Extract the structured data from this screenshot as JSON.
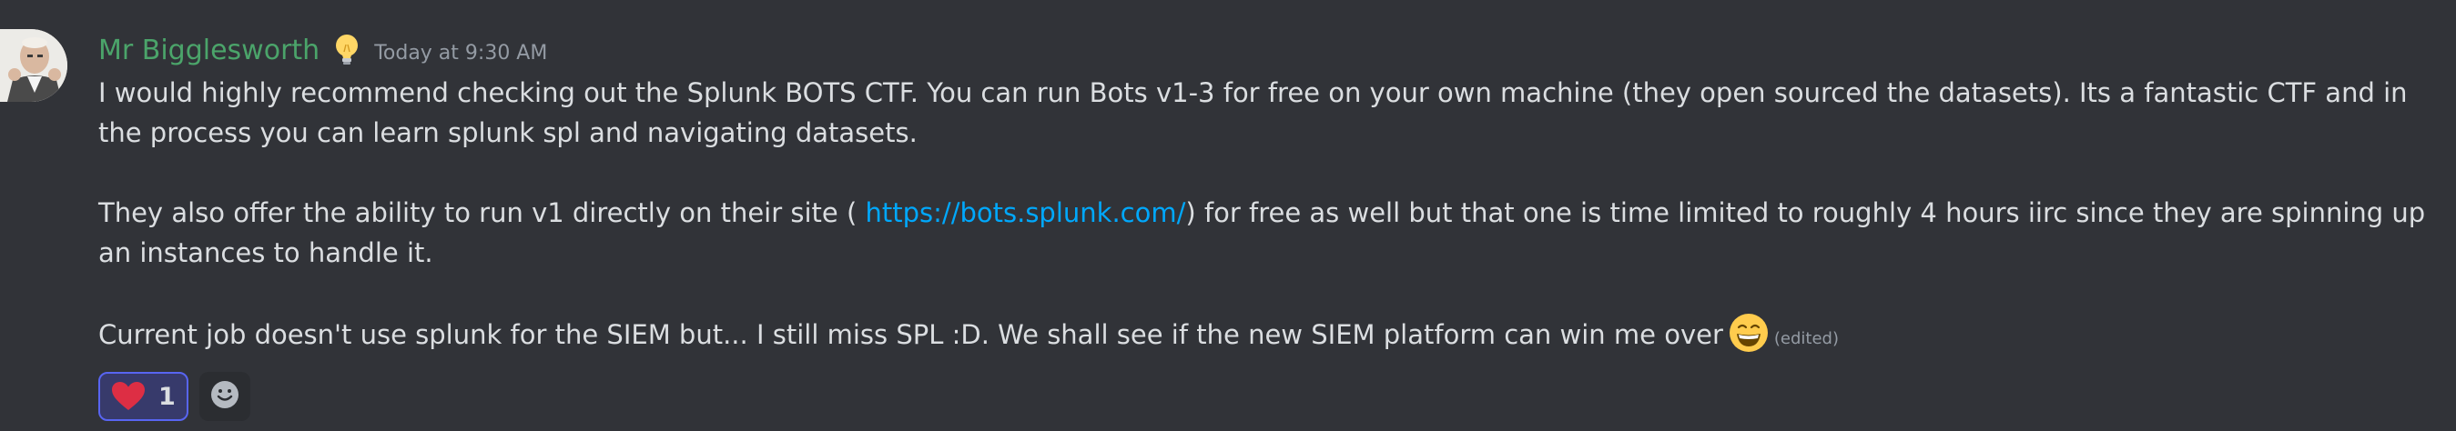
{
  "message": {
    "author": "Mr Bigglesworth",
    "author_badge_icon": "lightbulb-icon",
    "timestamp": "Today at 9:30 AM",
    "paragraph1": "I would highly recommend checking out the Splunk BOTS CTF. You can run Bots v1-3 for free on your own machine (they open sourced the datasets). Its a fantastic CTF and in the process you can learn splunk spl and navigating datasets.",
    "paragraph2_before": "They also offer the ability to run v1 directly on their site  ( ",
    "paragraph2_link": "https://bots.splunk.com/",
    "paragraph2_after": ") for free as well but that one is time limited to roughly 4 hours iirc since they are spinning up an instances to handle it.",
    "paragraph3": "Current job doesn't use splunk for the SIEM but... I still miss SPL :D. We shall see if the new SIEM platform can win me over",
    "paragraph3_emoji": "grinning-face-icon",
    "edited_label": "(edited)"
  },
  "reactions": [
    {
      "emoji": "red-heart-icon",
      "count": "1"
    }
  ],
  "add_reaction_icon": "add-reaction-smiley-icon",
  "colors": {
    "background": "#313338",
    "username": "#4ba46a",
    "text": "#dbdee1",
    "muted": "#949ba4",
    "link": "#00a8fc",
    "reaction_active_border": "#5865f2"
  }
}
